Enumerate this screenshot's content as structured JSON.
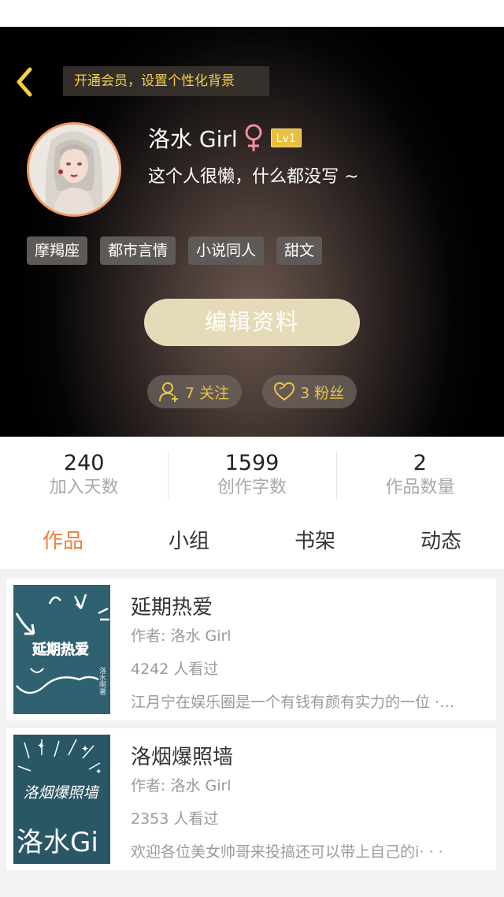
{
  "header": {
    "banner_text": "开通会员，设置个性化背景",
    "username": "洛水 Girl",
    "level": "Lv1",
    "bio": "这个人很懒，什么都没写 ~",
    "tags": [
      "摩羯座",
      "都市言情",
      "小说同人",
      "甜文"
    ],
    "edit_button": "编辑资料",
    "follow_label": "7 关注",
    "fans_label": "3 粉丝"
  },
  "colors": {
    "accent_orange": "#f0813c",
    "gold": "#e9c54a",
    "female_pink": "#f28fa0"
  },
  "icons": {
    "back": "chevron-left-icon",
    "gender": "female-symbol-icon",
    "follow": "person-add-icon",
    "fans": "heart-icon"
  },
  "stats": [
    {
      "value": "240",
      "label": "加入天数"
    },
    {
      "value": "1599",
      "label": "创作字数"
    },
    {
      "value": "2",
      "label": "作品数量"
    }
  ],
  "tabs": [
    {
      "label": "作品",
      "active": true
    },
    {
      "label": "小组",
      "active": false
    },
    {
      "label": "书架",
      "active": false
    },
    {
      "label": "动态",
      "active": false
    }
  ],
  "works": [
    {
      "title": "延期热爱",
      "author": "作者: 洛水 Girl",
      "views": "4242 人看过",
      "description": "江月宁在娱乐圈是一个有钱有颜有实力的一位 ·…",
      "cover_text": "延期热爱",
      "cover_side_text": "洛水啊著"
    },
    {
      "title": "洛烟爆照墙",
      "author": "作者: 洛水 Girl",
      "views": "2353 人看过",
      "description": "欢迎各位美女帅哥来投搞还可以带上自己的i· · ·",
      "cover_text": "洛烟爆照墙",
      "cover_side_text": "洛水Gi"
    }
  ]
}
